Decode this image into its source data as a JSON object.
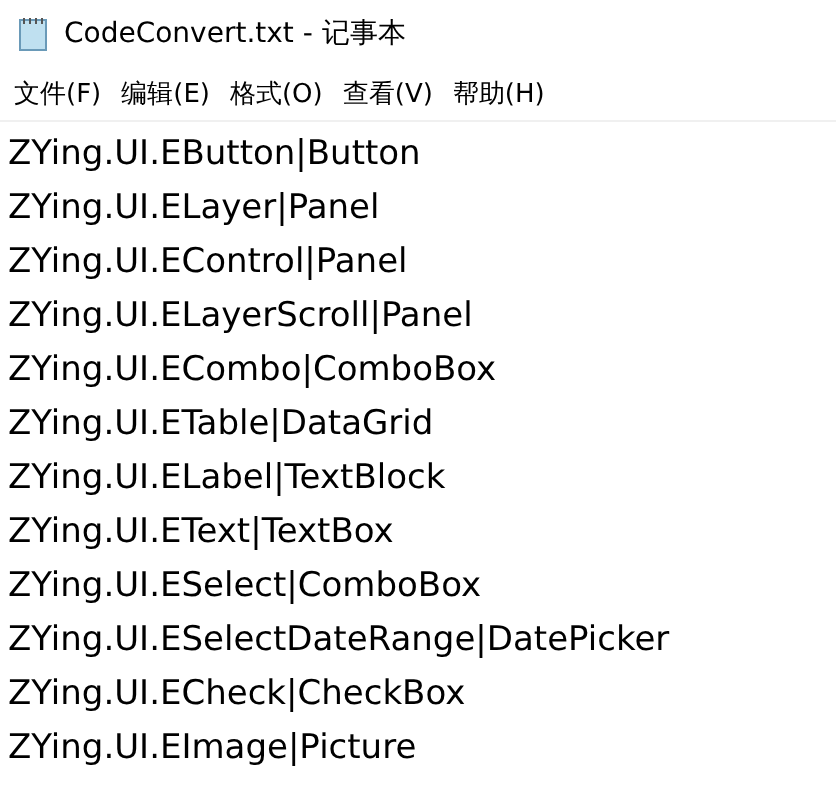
{
  "window": {
    "title": "CodeConvert.txt - 记事本"
  },
  "menu": [
    "文件(F)",
    "编辑(E)",
    "格式(O)",
    "查看(V)",
    "帮助(H)"
  ],
  "lines": [
    "ZYing.UI.EButton|Button",
    "ZYing.UI.ELayer|Panel",
    "ZYing.UI.EControl|Panel",
    "ZYing.UI.ELayerScroll|Panel",
    "ZYing.UI.ECombo|ComboBox",
    "ZYing.UI.ETable|DataGrid",
    "ZYing.UI.ELabel|TextBlock",
    "ZYing.UI.EText|TextBox",
    "ZYing.UI.ESelect|ComboBox",
    "ZYing.UI.ESelectDateRange|DatePicker",
    "ZYing.UI.ECheck|CheckBox",
    "ZYing.UI.EImage|Picture"
  ]
}
